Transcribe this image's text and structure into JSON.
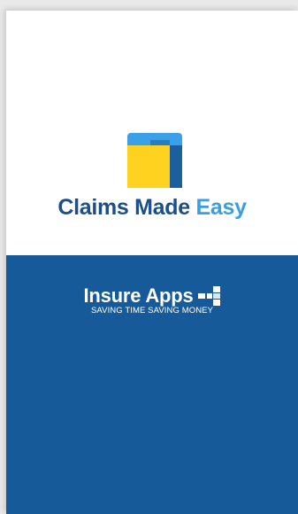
{
  "colors": {
    "top_background": "#ffffff",
    "bottom_background": "#175a9a",
    "title_main": "#1b4f8c",
    "title_accent": "#3a9ee4",
    "logo_yellow": "#ffd21f",
    "logo_light_blue": "#3aa1e8",
    "logo_dark_blue": "#1b5f9e"
  },
  "splash": {
    "logo_icon": "folder-document-icon",
    "title_main": "Claims Made ",
    "title_accent": "Easy"
  },
  "brand": {
    "name": "Insure Apps",
    "icon": "squares-logo-icon",
    "tagline": "SAVING TIME SAVING MONEY"
  }
}
